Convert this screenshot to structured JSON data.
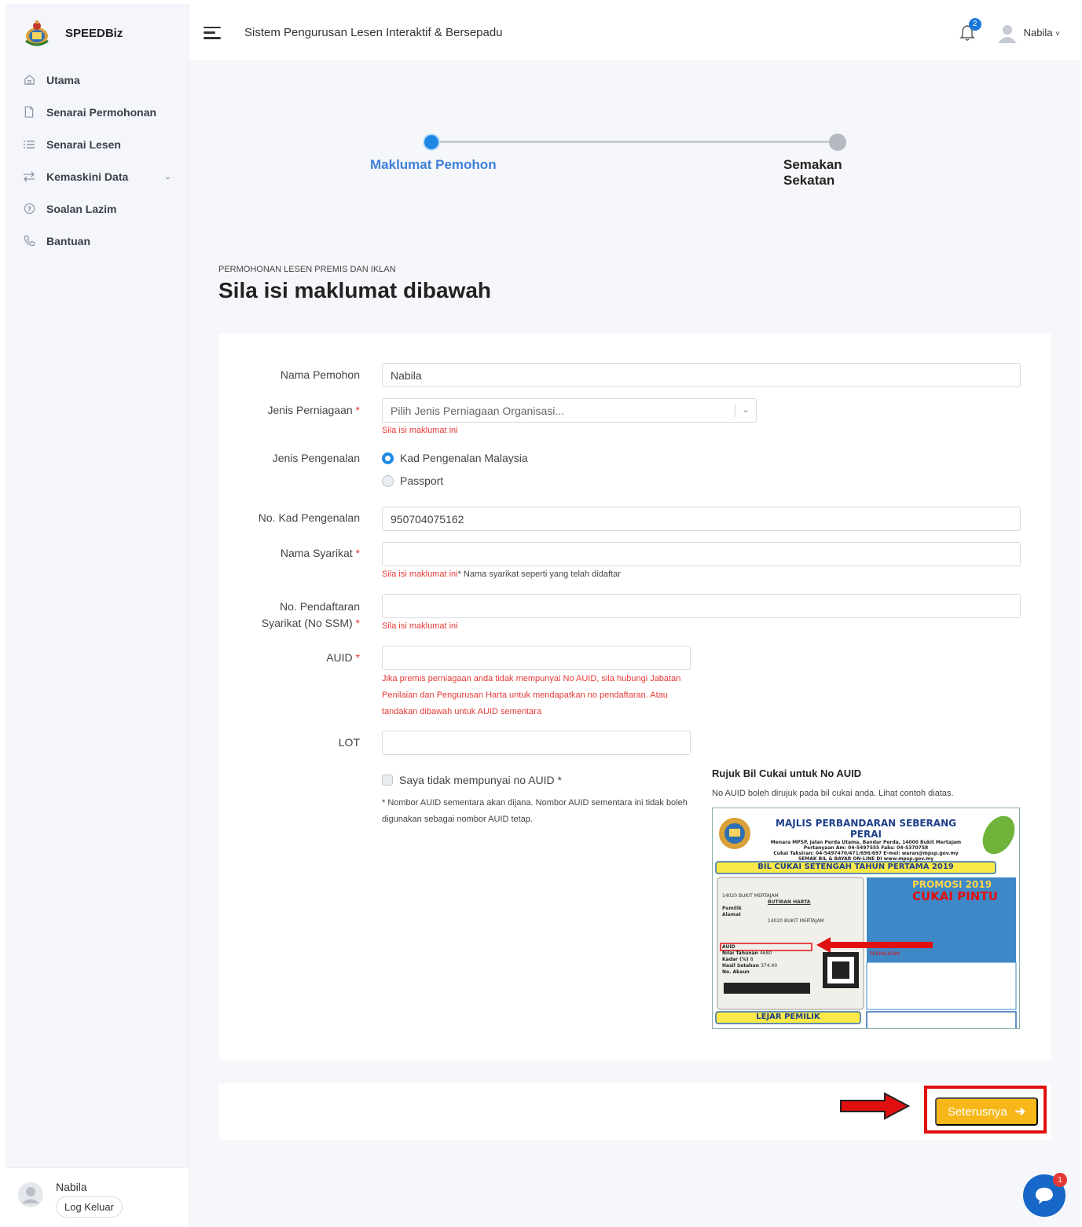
{
  "app": {
    "brand": "SPEEDBiz",
    "header_title": "Sistem Pengurusan Lesen Interaktif & Bersepadu"
  },
  "header": {
    "notification_count": "2",
    "user_name": "Nabila",
    "user_caret": "˅"
  },
  "sidebar": {
    "items": [
      {
        "label": "Utama",
        "icon": "home-icon"
      },
      {
        "label": "Senarai Permohonan",
        "icon": "file-icon"
      },
      {
        "label": "Senarai Lesen",
        "icon": "list-icon"
      },
      {
        "label": "Kemaskini Data",
        "icon": "swap-icon",
        "has_submenu": true
      },
      {
        "label": "Soalan Lazim",
        "icon": "help-circle-icon"
      },
      {
        "label": "Bantuan",
        "icon": "phone-icon"
      }
    ],
    "user": {
      "name": "Nabila",
      "logout_label": "Log Keluar"
    }
  },
  "stepper": {
    "steps": [
      {
        "label": "Maklumat Pemohon",
        "state": "active"
      },
      {
        "label": "Semakan Sekatan",
        "state": "inactive"
      }
    ]
  },
  "page": {
    "pre_title": "PERMOHONAN LESEN PREMIS DAN IKLAN",
    "title": "Sila isi maklumat dibawah"
  },
  "form": {
    "nama_pemohon": {
      "label": "Nama Pemohon",
      "value": "Nabila"
    },
    "jenis_perniagaan": {
      "label": "Jenis Perniagaan",
      "required": "*",
      "placeholder": "Pilih Jenis Perniagaan Organisasi...",
      "error": "Sila isi maklumat ini"
    },
    "jenis_pengenalan": {
      "label": "Jenis Pengenalan",
      "options": [
        {
          "label": "Kad Pengenalan Malaysia",
          "selected": true
        },
        {
          "label": "Passport",
          "selected": false
        }
      ]
    },
    "no_kad": {
      "label": "No. Kad Pengenalan",
      "value": "950704075162"
    },
    "nama_syarikat": {
      "label": "Nama Syarikat",
      "required": "*",
      "value": "",
      "error": "Sila isi maklumat ini",
      "hint": "* Nama syarikat seperti yang telah didaftar"
    },
    "no_pendaftaran": {
      "label_line1": "No. Pendaftaran",
      "label_line2": "Syarikat (No SSM)",
      "required": "*",
      "value": "",
      "error": "Sila isi maklumat ini"
    },
    "auid": {
      "label": "AUID",
      "required": "*",
      "value": "",
      "error_line1": "Jika premis perniagaan anda tidak mempunyai No AUID, sila hubungi Jabatan",
      "error_line2": "Penilaian dan Pengurusan Harta untuk mendapatkan no pendaftaran. Atau",
      "error_line3": "tandakan dibawah untuk AUID sementara"
    },
    "lot": {
      "label": "LOT",
      "value": ""
    },
    "no_auid_checkbox": {
      "label": "Saya tidak mempunyai no AUID *",
      "checked": false
    },
    "no_auid_note_line1": "* Nombor AUID sementara akan dijana. Nombor AUID sementara ini tidak boleh",
    "no_auid_note_line2": "digunakan sebagai nombor AUID tetap."
  },
  "reference": {
    "title": "Rujuk Bil Cukai untuk No AUID",
    "subtitle": "No AUID boleh dirujuk pada bil cukai anda. Lihat contoh diatas.",
    "bill": {
      "org": "MAJLIS PERBANDARAN SEBERANG PERAI",
      "addr1": "Menara MPSP, Jalan Perda Utama, Bandar Perda, 14000 Bukit Mertajam",
      "addr2": "Pertanyaan Am: 04-5497555 Faks: 04-5370758",
      "addr3": "Cukai Taksiran: 04-5497470/471/696/697 E-mel: waran@mpsp.gov.my",
      "addr4": "SEMAK BIL & BAYAR ON-LINE DI www.mpsp.gov.my",
      "banner": "BIL CUKAI SETENGAH TAHUN PERTAMA 2019",
      "promo1": "PROMOSI 2019",
      "promo2": "CUKAI PINTU",
      "bottom_banner": "LEJAR PEMILIK",
      "field_auid": "AUID",
      "field_nilai": "Nilai Tahunan",
      "field_nilai_val": "4680",
      "field_kadar": "Kadar (%)",
      "field_kadar_val": "8",
      "field_hasil": "Hasil Setahun",
      "field_hasil_val": "374.40",
      "field_akaun": "No. Akaun",
      "butiran": "BUTIRAN HARTA",
      "pemilik": "Pemilik",
      "alamat": "Alamat",
      "city": "14020 BUKIT MERTAJAM",
      "peringatan": "PERINGATAN"
    }
  },
  "footer": {
    "next_label": "Seterusnya",
    "next_arrow": "➔"
  },
  "chat": {
    "badge": "1"
  },
  "colors": {
    "primary": "#1e88e5",
    "accent": "#f7b718",
    "error": "#e53935",
    "highlight": "#e01010"
  }
}
